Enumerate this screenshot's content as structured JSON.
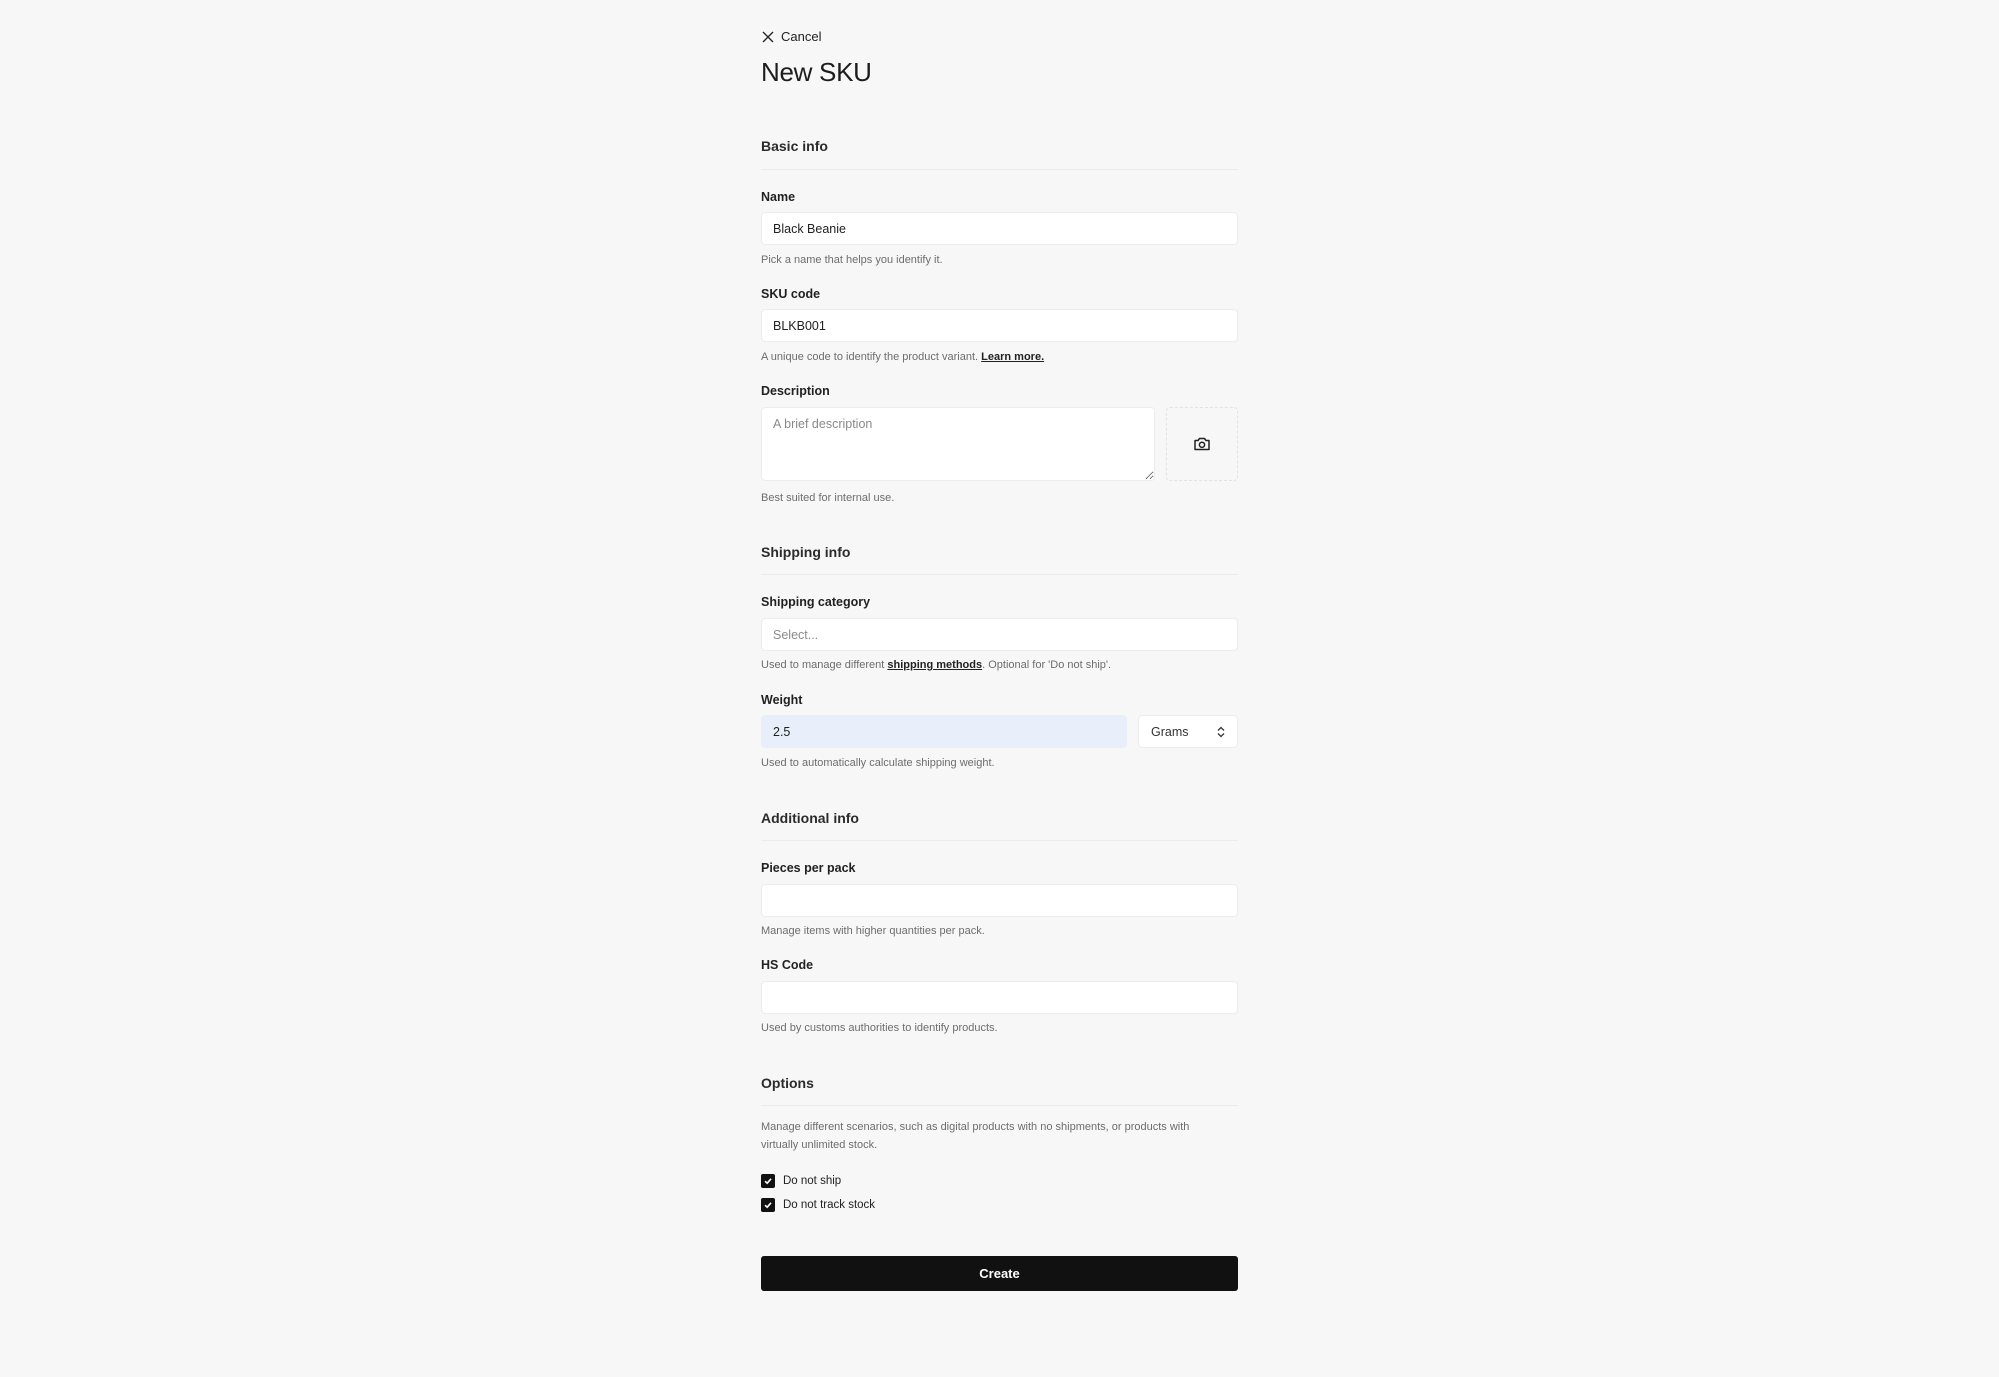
{
  "header": {
    "cancel_label": "Cancel",
    "title": "New SKU"
  },
  "sections": {
    "basic": {
      "title": "Basic info",
      "name": {
        "label": "Name",
        "value": "Black Beanie",
        "help": "Pick a name that helps you identify it."
      },
      "sku_code": {
        "label": "SKU code",
        "value": "BLKB001",
        "help": "A unique code to identify the product variant.",
        "help_link": "Learn more."
      },
      "description": {
        "label": "Description",
        "value": "",
        "placeholder": "A brief description",
        "help": "Best suited for internal use.",
        "photo_icon": "camera-icon"
      }
    },
    "shipping": {
      "title": "Shipping info",
      "category": {
        "label": "Shipping category",
        "placeholder": "Select...",
        "help_prefix": "Used to manage different ",
        "help_link": "shipping methods",
        "help_suffix": ". Optional for 'Do not ship'."
      },
      "weight": {
        "label": "Weight",
        "value": "2.5",
        "unit": "Grams",
        "help": "Used to automatically calculate shipping weight."
      }
    },
    "additional": {
      "title": "Additional info",
      "pieces": {
        "label": "Pieces per pack",
        "value": "",
        "help": "Manage items with higher quantities per pack."
      },
      "hs_code": {
        "label": "HS Code",
        "value": "",
        "help": "Used by customs authorities to identify products."
      }
    },
    "options": {
      "title": "Options",
      "description": "Manage different scenarios, such as digital products with no shipments, or products with virtually unlimited stock.",
      "checkboxes": [
        {
          "label": "Do not ship",
          "checked": true
        },
        {
          "label": "Do not track stock",
          "checked": true
        }
      ]
    }
  },
  "footer": {
    "create_label": "Create"
  }
}
